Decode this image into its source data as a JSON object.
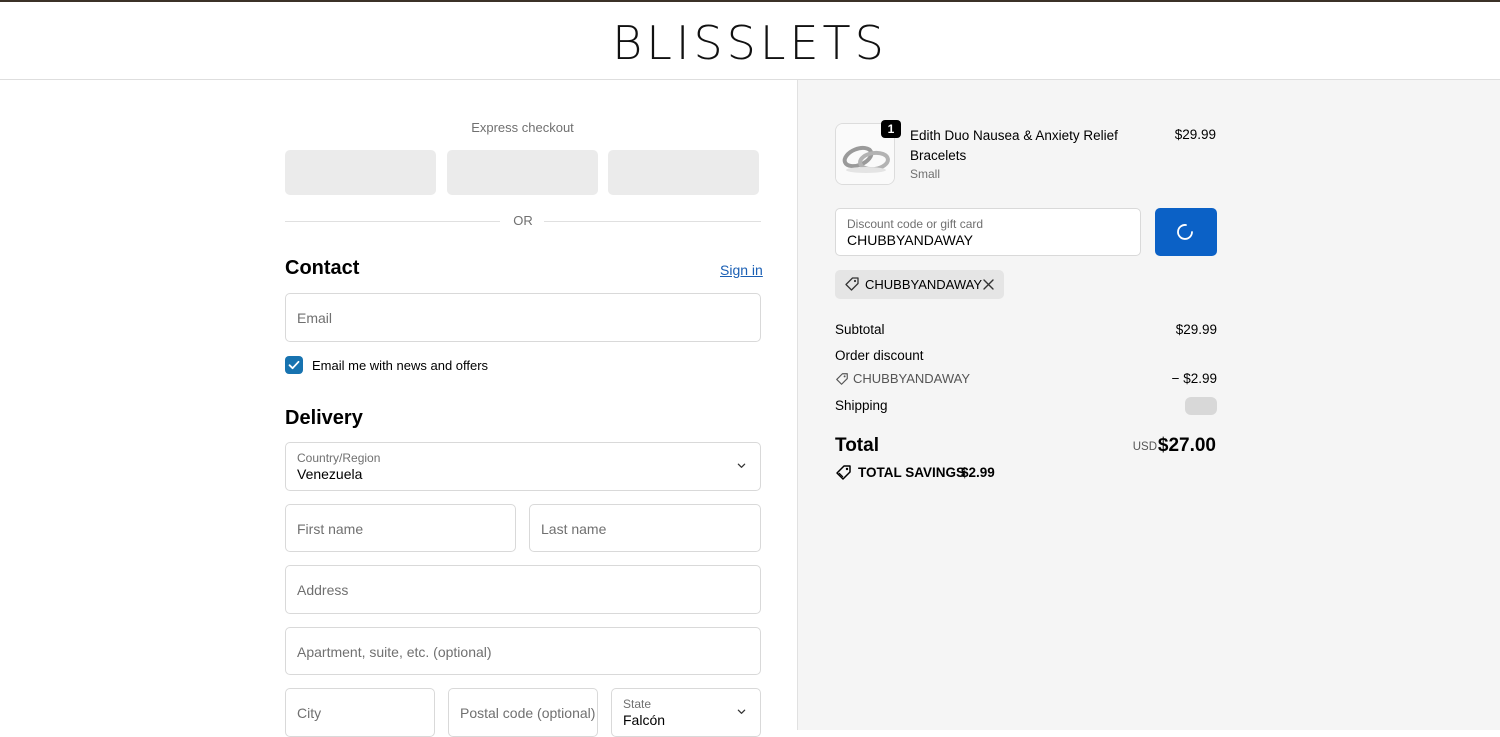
{
  "header": {
    "logo": "BLISSLETS"
  },
  "checkout": {
    "express_title": "Express checkout",
    "or_text": "OR",
    "contact": {
      "title": "Contact",
      "sign_in": "Sign in",
      "email_placeholder": "Email",
      "newsletter_label": "Email me with news and offers",
      "newsletter_checked": true
    },
    "delivery": {
      "title": "Delivery",
      "country_label": "Country/Region",
      "country_value": "Venezuela",
      "first_name_placeholder": "First name",
      "last_name_placeholder": "Last name",
      "address_placeholder": "Address",
      "apartment_placeholder": "Apartment, suite, etc. (optional)",
      "city_placeholder": "City",
      "postal_placeholder": "Postal code (optional)",
      "state_label": "State",
      "state_value": "Falcón"
    }
  },
  "summary": {
    "product": {
      "name": "Edith Duo Nausea & Anxiety Relief Bracelets",
      "variant": "Small",
      "price": "$29.99",
      "quantity": "1"
    },
    "discount": {
      "label": "Discount code or gift card",
      "value": "CHUBBYANDAWAY",
      "applied_code": "CHUBBYANDAWAY"
    },
    "subtotal_label": "Subtotal",
    "subtotal_value": "$29.99",
    "order_discount_label": "Order discount",
    "order_discount_code": "CHUBBYANDAWAY",
    "order_discount_value": "− $2.99",
    "shipping_label": "Shipping",
    "total_label": "Total",
    "total_currency": "USD",
    "total_value": "$27.00",
    "savings_label": "TOTAL SAVINGS",
    "savings_value": "$2.99"
  },
  "colors": {
    "accent": "#0b61c6",
    "checkbox": "#1773b0",
    "link": "#1a5fb4",
    "summary_bg": "#f5f5f5"
  },
  "icons": [
    "tag-icon",
    "close-icon",
    "chevron-down-icon",
    "check-icon",
    "spinner-icon",
    "savings-tag-icon"
  ]
}
